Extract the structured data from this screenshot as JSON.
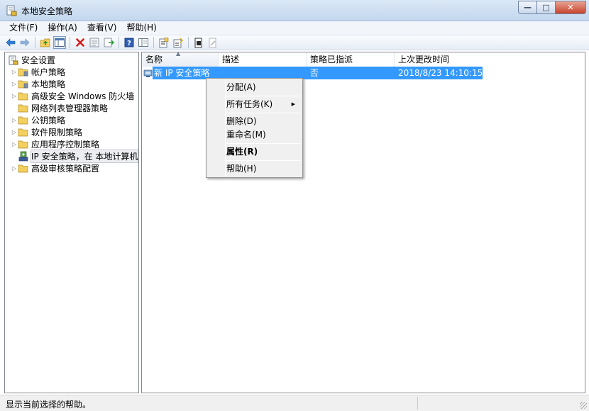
{
  "window": {
    "title": "本地安全策略",
    "minimize_glyph": "—",
    "maximize_glyph": "□",
    "close_glyph": "✕"
  },
  "menubar": [
    {
      "label": "文件(F)"
    },
    {
      "label": "操作(A)"
    },
    {
      "label": "查看(V)"
    },
    {
      "label": "帮助(H)"
    }
  ],
  "toolbar": {
    "icons": [
      "back-arrow-icon",
      "forward-arrow-icon",
      "up-folder-icon",
      "show-hide-tree-icon",
      "delete-icon",
      "properties-icon",
      "export-list-icon",
      "help-icon",
      "console-tree-icon",
      "manage-ip-filter-icon",
      "create-ip-policy-icon",
      "assign-policy-icon",
      "unassign-policy-icon"
    ]
  },
  "tree": {
    "root": {
      "label": "安全设置",
      "icon": "security-settings-icon"
    },
    "items": [
      {
        "label": "帐户策略",
        "expandable": true,
        "icon": "policy-folder-icon"
      },
      {
        "label": "本地策略",
        "expandable": true,
        "icon": "policy-folder-icon"
      },
      {
        "label": "高级安全 Windows 防火墙",
        "expandable": true,
        "icon": "folder-icon"
      },
      {
        "label": "网络列表管理器策略",
        "expandable": false,
        "icon": "folder-icon"
      },
      {
        "label": "公钥策略",
        "expandable": true,
        "icon": "folder-icon"
      },
      {
        "label": "软件限制策略",
        "expandable": true,
        "icon": "folder-icon"
      },
      {
        "label": "应用程序控制策略",
        "expandable": true,
        "icon": "folder-icon"
      },
      {
        "label": "IP 安全策略，在 本地计算机",
        "expandable": false,
        "icon": "ip-security-icon",
        "selected": true
      },
      {
        "label": "高级审核策略配置",
        "expandable": true,
        "icon": "folder-icon"
      }
    ]
  },
  "list": {
    "columns": [
      "名称",
      "描述",
      "策略已指派",
      "上次更改时间"
    ],
    "rows": [
      {
        "name": "新 IP 安全策略",
        "description": "",
        "assigned": "否",
        "modified": "2018/8/23 14:10:15"
      }
    ]
  },
  "context_menu": {
    "items": [
      {
        "label": "分配(A)"
      },
      {
        "label": "所有任务(K)",
        "submenu_glyph": "▶"
      },
      {
        "label": "删除(D)"
      },
      {
        "label": "重命名(M)"
      },
      {
        "label": "属性(R)"
      },
      {
        "label": "帮助(H)"
      }
    ]
  },
  "status": {
    "text": "显示当前选择的帮助。"
  },
  "colors": {
    "selection": "#3399ff",
    "window_frame": "#c3d7ee",
    "close_button": "#c7432b"
  }
}
